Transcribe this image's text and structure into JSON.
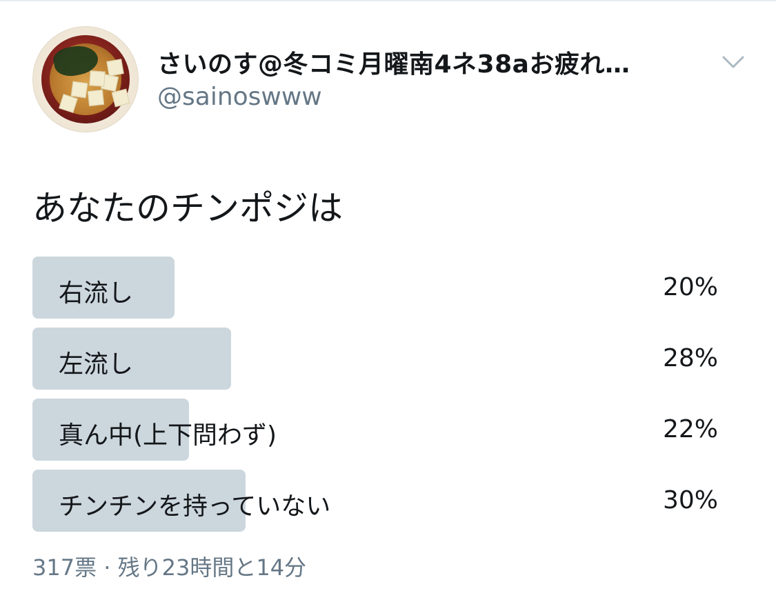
{
  "tweet": {
    "display_name": "さいのす@冬コミ月曜南4ネ38aお疲れ…",
    "handle": "@sainoswww",
    "menu_icon": "chevron-down-icon",
    "avatar_icon": "miso-soup-avatar"
  },
  "poll": {
    "question": "あなたのチンポジは",
    "options": [
      {
        "label": "右流し",
        "percent_text": "20%",
        "percent": 20
      },
      {
        "label": "左流し",
        "percent_text": "28%",
        "percent": 28
      },
      {
        "label": "真ん中(上下問わず)",
        "percent_text": "22%",
        "percent": 22
      },
      {
        "label": "チンチンを持っていない",
        "percent_text": "30%",
        "percent": 30
      }
    ],
    "votes": "317票",
    "separator": "·",
    "time_left": "残り23時間と14分"
  },
  "colors": {
    "bar": "#ccd6dd",
    "secondary_text": "#657786",
    "primary_text": "#14171a"
  }
}
